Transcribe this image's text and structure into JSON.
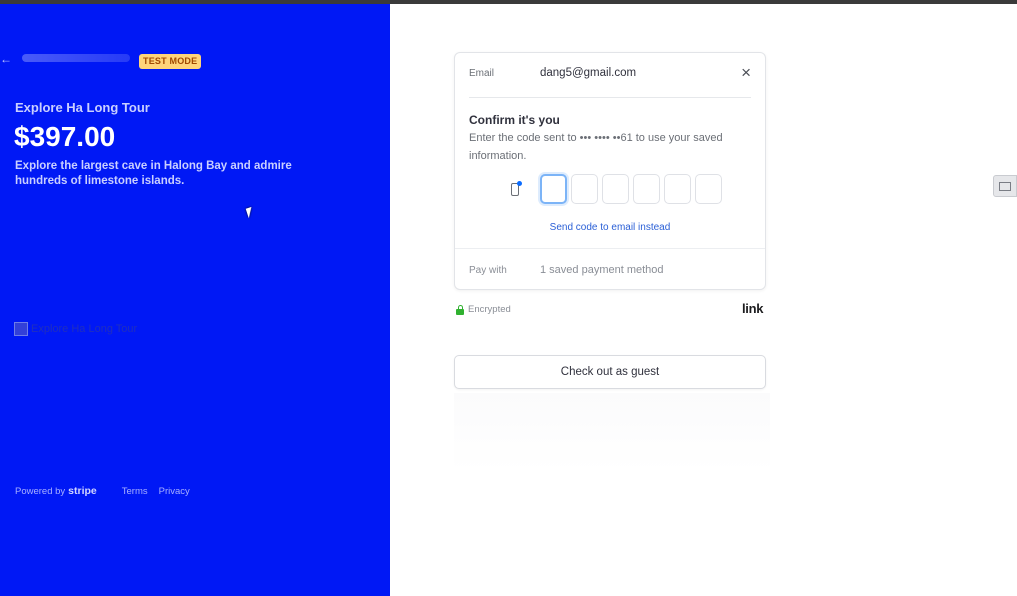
{
  "header": {
    "test_badge": "TEST MODE"
  },
  "product": {
    "name": "Explore Ha Long Tour",
    "price": "$397.00",
    "description": "Explore the largest cave in Halong Bay and admire hundreds of limestone islands.",
    "image_alt": "Explore Ha Long Tour"
  },
  "footer": {
    "powered_by": "Powered by",
    "stripe": "stripe",
    "terms": "Terms",
    "privacy": "Privacy"
  },
  "link_auth": {
    "email_label": "Email",
    "email_value": "dang5@gmail.com",
    "close_icon": "×",
    "confirm_title": "Confirm it's you",
    "confirm_text": "Enter the code sent to ••• •••• ••61 to use your saved information.",
    "send_code_link": "Send code to email instead",
    "pay_with_label": "Pay with",
    "pay_with_value": "1 saved payment method",
    "code_digits": 6
  },
  "security": {
    "encrypted": "Encrypted",
    "link_logo": "link"
  },
  "actions": {
    "guest_checkout": "Check out as guest"
  },
  "colors": {
    "left_panel": "#0018f5",
    "badge_bg": "#ffd47a",
    "badge_text": "#a14800",
    "link_blue": "#2a5fd6",
    "lock_green": "#30b130"
  }
}
